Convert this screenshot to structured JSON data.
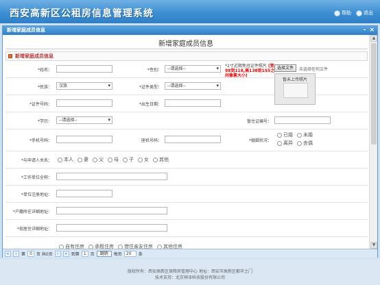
{
  "header": {
    "app_title": "西安高新区公租房信息管理系统",
    "help_label": "帮助",
    "exit_label": "退出"
  },
  "dialog": {
    "title": "新增家庭成员信息",
    "min_icon": "-",
    "close_icon": "×"
  },
  "form": {
    "title": "新增家庭成员信息",
    "section_title": "新增家庭成员信息",
    "fields": {
      "name_label": "*姓名：",
      "name_value": "",
      "gender_label": "*性别：",
      "gender_value": "--请选择--",
      "ethnicity_label": "*民族：",
      "ethnicity_value": "汉族",
      "id_type_label": "*证件类型：",
      "id_type_value": "--请选择--",
      "id_number_label": "*证件号码：",
      "id_number_value": "",
      "birth_date_label": "*出生日期：",
      "birth_date_value": "",
      "education_label": "*学历：",
      "education_value": "--请选择--",
      "residence_permit_label": "暂住证编号：",
      "residence_permit_value": "",
      "mobile_label": "*手机号码：",
      "mobile_value": "",
      "landline_label": "座机号码：",
      "landline_value": "",
      "marital_label": "*婚姻状况：",
      "relation_label": "*与申请人关系：",
      "employer_label": "*工作单位全称：",
      "employer_value": "",
      "employer_address_label": "*单位注册地址：",
      "employer_address_value": "",
      "hukou_address_label": "*户籍所在详细地址：",
      "hukou_address_value": "",
      "current_address_label": "*现居住详细地址："
    },
    "marital_options": [
      "已婚",
      "未婚",
      "离异",
      "丧偶"
    ],
    "relation_options": [
      "本人",
      "妻",
      "父",
      "母",
      "子",
      "女",
      "其他"
    ],
    "housing_options": [
      "自有住房",
      "承租住房",
      "借住亲友住房",
      "其他住房"
    ],
    "photo": {
      "note_prefix": "*2寸近期免冠证件照片",
      "note_red": "(宽98到118,高138到155之间像素大小)",
      "upload_button": "选择文件",
      "upload_hint": "未选择任何文件",
      "placeholder_text": "暂未上传照片"
    }
  },
  "pager": {
    "page_label": "第",
    "page_value": "0",
    "total_label": "页 共0页",
    "jump_label": "到第",
    "jump_value": "1",
    "jump_unit": "页",
    "go_button": "跳转",
    "per_page_label": "每页",
    "per_page_value": "20",
    "per_page_unit": "条"
  },
  "footer": {
    "line1": "版权所有：西安高新区保障房管理中心 地址：西安市高新区都市之门",
    "line2": "技术支持：北京神泽科技股份有限公司"
  }
}
